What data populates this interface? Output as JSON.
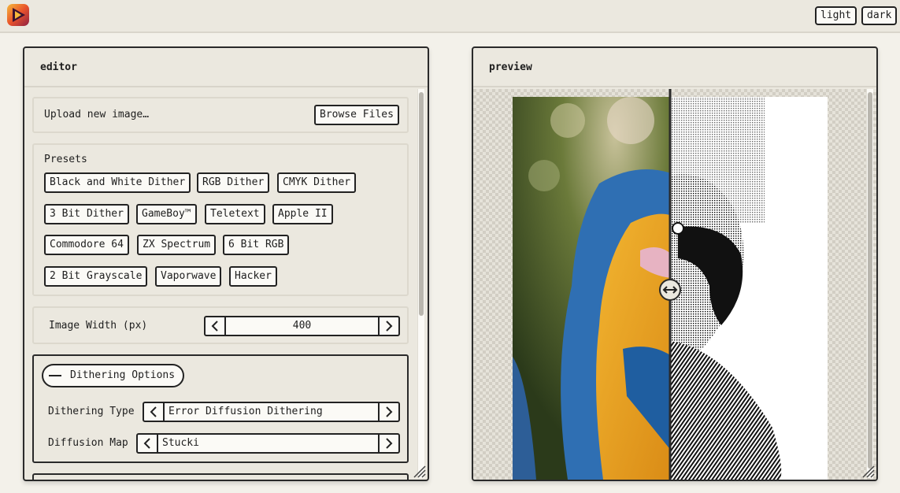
{
  "header": {
    "logo_icon": "play-triangle-logo",
    "theme_light_label": "light",
    "theme_dark_label": "dark"
  },
  "editor": {
    "title": "editor",
    "upload": {
      "label": "Upload new image…",
      "browse_label": "Browse Files"
    },
    "presets": {
      "title": "Presets",
      "items": [
        "Black and White Dither",
        "RGB Dither",
        "CMYK Dither",
        "3 Bit Dither",
        "GameBoy™",
        "Teletext",
        "Apple II",
        "Commodore 64",
        "ZX Spectrum",
        "6 Bit RGB",
        "2 Bit Grayscale",
        "Vaporwave",
        "Hacker"
      ]
    },
    "image_width": {
      "label": "Image Width (px)",
      "value": "400"
    },
    "dithering_options": {
      "toggle_label": "Dithering Options",
      "toggle_icon": "minus-icon",
      "type_label": "Dithering Type",
      "type_value": "Error Diffusion Dithering",
      "map_label": "Diffusion Map",
      "map_value": "Stucki"
    }
  },
  "preview": {
    "title": "preview",
    "compare_handle_icon": "left-right-arrows-icon",
    "colors": {
      "accent": "#f28b2a",
      "ink": "#222222",
      "panel": "#ebe8df"
    }
  }
}
